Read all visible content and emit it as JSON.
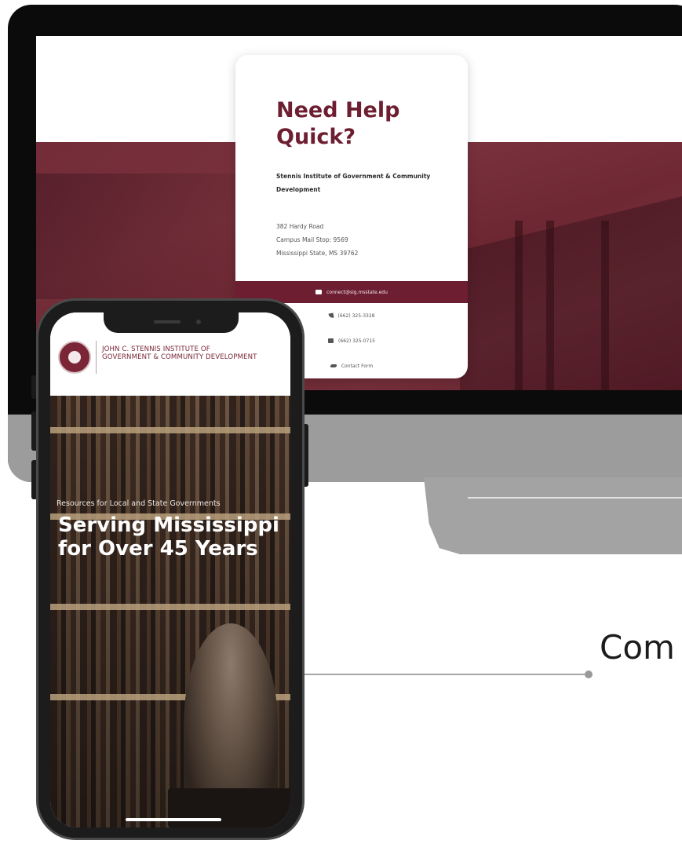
{
  "desktop": {
    "card": {
      "title": "Need Help Quick?",
      "org": "Stennis Institute of Government & Community Development",
      "address": [
        "382 Hardy Road",
        "Campus Mail Stop: 9569",
        "Mississippi State, MS 39762"
      ],
      "email": "connect@sig.msstate.edu",
      "phone": "(662) 325-3328",
      "fax": "(662) 325-0715",
      "contact_form": "Contact Form"
    }
  },
  "phone": {
    "org_line1": "JOHN C. STENNIS INSTITUTE OF",
    "org_line2": "GOVERNMENT & COMMUNITY DEVELOPMENT",
    "kicker": "Resources for Local and State Governments",
    "headline": "Serving Mississippi for Over 45 Years"
  },
  "caption": "Com",
  "colors": {
    "brand_maroon": "#6d1e30",
    "monitor_bezel": "#0b0b0b",
    "stand_gray": "#a3a3a3"
  }
}
